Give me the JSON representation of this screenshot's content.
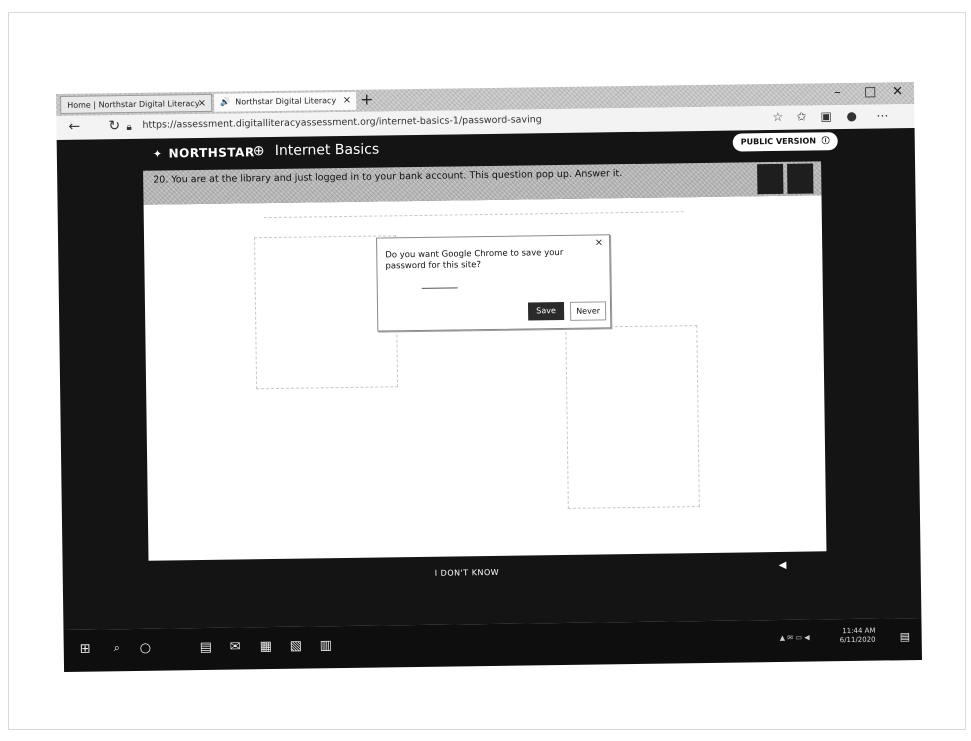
{
  "browser": {
    "tabs": [
      {
        "label": "Home | Northstar Digital Literacy"
      },
      {
        "label": "Northstar Digital Literacy"
      }
    ],
    "new_tab_glyph": "+",
    "window_controls": [
      "–",
      "□",
      "✕"
    ],
    "url": "https://assessment.digitalliteracyassessment.org/internet-basics-1/password-saving",
    "nav_icons": [
      "back-arrow-icon",
      "refresh-icon",
      "lock-icon"
    ],
    "toolbar_icons": [
      "favorite-icon",
      "favorites-list-icon",
      "collections-icon",
      "profile-icon",
      "more-icon"
    ]
  },
  "page": {
    "logo_text": "NORTHSTAR",
    "course_title": "Internet Basics",
    "public_version_label": "PUBLIC VERSION",
    "question": "20. You are at the library and just logged in to your bank account. This question pop up. Answer it.",
    "dialog": {
      "message": "Do you want Google Chrome to save your password for this site?",
      "save_label": "Save",
      "never_label": "Never",
      "close_glyph": "×"
    },
    "dont_know_label": "I DON'T KNOW"
  },
  "taskbar": {
    "icons": [
      "windows-start-icon",
      "search-icon",
      "cortana-icon",
      "store-icon",
      "mail-icon",
      "word-icon",
      "publisher-icon",
      "calculator-icon"
    ],
    "clock_time": "11:44 AM",
    "clock_date": "6/11/2020"
  },
  "colors": {
    "page_background": "#141414",
    "question_bar": "#b9b9b9",
    "save_button": "#2a2a2a"
  }
}
